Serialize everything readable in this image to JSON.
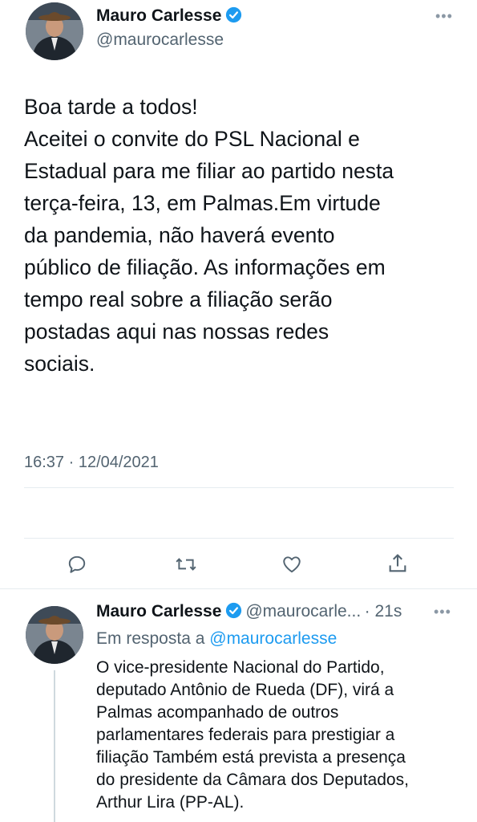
{
  "main_tweet": {
    "author_name": "Mauro Carlesse",
    "author_handle": "@maurocarlesse",
    "more_label": "•••",
    "text": "Boa tarde a todos!\nAceitei o convite do PSL Nacional e\nEstadual para me filiar ao partido nesta\nterça-feira, 13, em Palmas.Em virtude\nda pandemia, não haverá evento\npúblico de filiação. As informações em\ntempo real sobre a filiação serão\npostadas aqui nas nossas redes\nsociais.",
    "timestamp": "16:37 · 12/04/2021",
    "actions": [
      "reply-icon",
      "retweet-icon",
      "like-icon",
      "share-icon"
    ]
  },
  "reply_tweet": {
    "author_name": "Mauro Carlesse",
    "author_handle": "@maurocarle...",
    "time": "· 21s",
    "more_label": "•••",
    "in_reply_prefix": "Em resposta a",
    "in_reply_handle": "@maurocarlesse",
    "text": "O vice-presidente Nacional do Partido,\ndeputado Antônio de Rueda (DF), virá a\nPalmas acompanhado de outros\nparlamentares federais para prestigiar a\nfiliação Também está prevista a presença\ndo presidente da Câmara dos Deputados,\nArthur Lira (PP-AL)."
  },
  "colors": {
    "accent": "#1d9bf0",
    "secondary_text": "#536471",
    "divider": "#e6ecf0"
  }
}
